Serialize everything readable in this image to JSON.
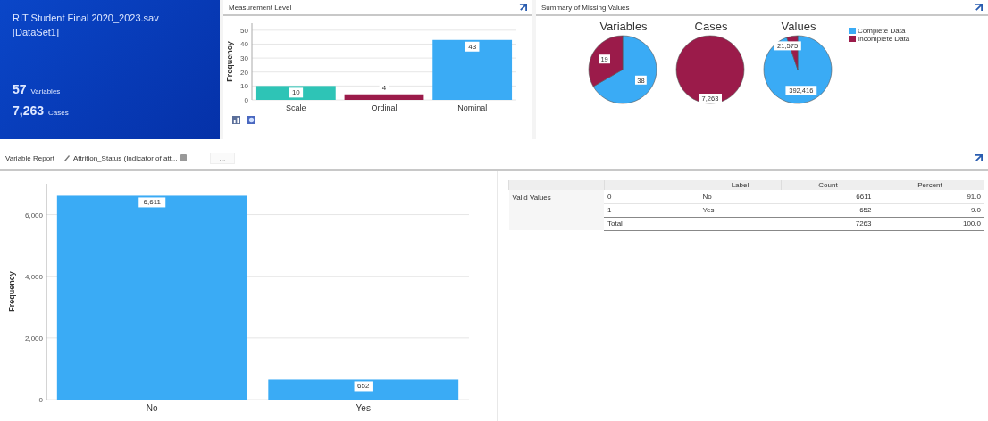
{
  "dataset_card": {
    "file": "RIT Student Final 2020_2023.sav",
    "dataset": "[DataSet1]",
    "stats": [
      {
        "value": "57",
        "label": "Variables"
      },
      {
        "value": "7,263",
        "label": "Cases"
      }
    ]
  },
  "measurement_panel": {
    "title": "Measurement Level",
    "chart_data": {
      "type": "bar",
      "ylabel": "Frequency",
      "categories": [
        "Scale",
        "Ordinal",
        "Nominal"
      ],
      "colors": [
        "#2ec4b6",
        "#9b1b4a",
        "#3aabf5"
      ],
      "values": [
        10,
        4,
        43
      ],
      "ylim": [
        0,
        55
      ],
      "yticks": [
        0,
        10,
        20,
        30,
        40,
        50
      ],
      "grid": true,
      "value_labels": [
        "10",
        "4",
        "43"
      ]
    }
  },
  "missing_panel": {
    "title": "Summary of Missing Values",
    "legend": [
      {
        "label": "Complete Data",
        "color": "#3aabf5"
      },
      {
        "label": "Incomplete Data",
        "color": "#9b1b4a"
      }
    ],
    "charts": [
      {
        "chart_data": {
          "type": "pie",
          "title": "Variables",
          "values": [
            38,
            19
          ],
          "value_labels": [
            "38",
            "19"
          ]
        }
      },
      {
        "chart_data": {
          "type": "pie",
          "title": "Cases",
          "values": [
            0,
            7263
          ],
          "value_labels": [
            null,
            "7,263"
          ]
        }
      },
      {
        "chart_data": {
          "type": "pie",
          "title": "Values",
          "values": [
            392416,
            21575
          ],
          "value_labels": [
            "392,416",
            "21,575"
          ]
        }
      }
    ]
  },
  "variable_report": {
    "label": "Variable Report",
    "variable": "Attrition_Status  (Indicator of att...",
    "more_button": "...",
    "chart_data": {
      "type": "bar",
      "ylabel": "Frequency",
      "categories": [
        "No",
        "Yes"
      ],
      "values": [
        6611,
        652
      ],
      "ylim": [
        0,
        7000
      ],
      "yticks": [
        {
          "value": 0,
          "label": "0"
        },
        {
          "value": 2000,
          "label": "2,000"
        },
        {
          "value": 4000,
          "label": "4,000"
        },
        {
          "value": 6000,
          "label": "6,000"
        }
      ],
      "grid": true,
      "value_labels": [
        "6,611",
        "652"
      ],
      "color": "#3aabf5"
    },
    "table": {
      "columns": [
        "Label",
        "Count",
        "Percent"
      ],
      "group": "Valid Values",
      "rows": [
        {
          "value": "0",
          "label": "No",
          "count": "6611",
          "percent": "91.0"
        },
        {
          "value": "1",
          "label": "Yes",
          "count": "652",
          "percent": "9.0"
        },
        {
          "value": "Total",
          "label": "",
          "count": "7263",
          "percent": "100.0"
        }
      ]
    }
  }
}
